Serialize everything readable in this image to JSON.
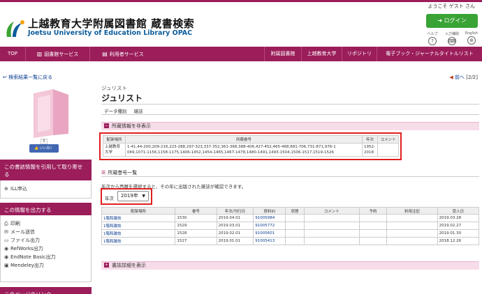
{
  "header": {
    "welcome": "ようこそ ゲスト さん",
    "title": "上越教育大学附属図書館 蔵書検索",
    "subtitle": "Joetsu University of Education Library OPAC",
    "login": "ログイン",
    "tools": [
      {
        "label": "ヘルプ",
        "icon": "?"
      },
      {
        "label": "入力補助",
        "icon": "⌨"
      },
      {
        "label": "English",
        "icon": "⊕"
      }
    ]
  },
  "nav": {
    "items": [
      {
        "label": "TOP",
        "icon": ""
      },
      {
        "label": "図書館サービス",
        "icon": "▥"
      },
      {
        "label": "利用者サービス",
        "icon": "▤"
      },
      {
        "label": "附属図書館",
        "icon": ""
      },
      {
        "label": "上越教育大学",
        "icon": ""
      },
      {
        "label": "リポジトリ",
        "icon": ""
      },
      {
        "label": "電子ブック・ジャーナルタイトルリスト",
        "icon": ""
      }
    ]
  },
  "breadcrumb": {
    "back": "検索結果一覧に戻る",
    "prev": "前へ",
    "page": "[2/2]"
  },
  "record": {
    "kicker": "ジュリスト",
    "title": "ジュリスト",
    "meta_label": "データ種別",
    "meta_value": "雑誌",
    "like_count": "0",
    "like_label": "いいね！"
  },
  "holdings": {
    "toggle_label": "所蔵情報を非表示",
    "headers": [
      "配架場所",
      "所蔵巻号",
      "年次",
      "コメント"
    ],
    "row": {
      "location": "上越教育大学",
      "volumes_1": "1-41,44-200,209-216,223-288,297-323,337-352,361-368,388-406,427-452,465-468,681-706,731-871,976-1",
      "volumes_2": "069,1071-1156,1158-1175,1406-1452,1454-1465,1467-1478,1480-1491,1493-1504,1506-1517,1519-1526",
      "years": "1952-2018",
      "comment": ""
    }
  },
  "volume_list": {
    "title": "所蔵巻号一覧",
    "hint": "年次から西暦を選択すると、その年に出版された雑誌が確認できます。",
    "year_label": "年次",
    "year_value": "2019年",
    "headers": [
      "配架場所",
      "巻号",
      "年次/刊行日",
      "資料ID",
      "状態",
      "コメント",
      "予約",
      "利用注記",
      "受入日"
    ],
    "rows": [
      [
        "1階和雑誌",
        "1530",
        "2019.04.01",
        "91005984",
        "",
        "",
        "",
        "",
        "2019.03.28"
      ],
      [
        "1階和雑誌",
        "1529",
        "2019.03.01",
        "91005772",
        "",
        "",
        "",
        "",
        "2019.02.27"
      ],
      [
        "1階和雑誌",
        "1528",
        "2019.02.01",
        "91005601",
        "",
        "",
        "",
        "",
        "2019.01.30"
      ],
      [
        "1階和雑誌",
        "1527",
        "2019.01.01",
        "91005413",
        "",
        "",
        "",
        "",
        "2018.12.26"
      ]
    ]
  },
  "details_toggle": "書誌詳細を表示",
  "sidebar": {
    "cite_heading": "この書誌情報を引用して取り寄せる",
    "cite_items": [
      {
        "label": "ILL申込",
        "icon": "⊕"
      }
    ],
    "output_heading": "この情報を出力する",
    "output_items": [
      {
        "label": "印刷",
        "icon": "⎙"
      },
      {
        "label": "メール送信",
        "icon": "✉"
      },
      {
        "label": "ファイル出力",
        "icon": "▭"
      },
      {
        "label": "RefWorks出力",
        "icon": "◉"
      },
      {
        "label": "EndNote Basic出力",
        "icon": "◉"
      },
      {
        "label": "Mendeley出力",
        "icon": "▣"
      }
    ],
    "link_heading": "このページのリンク"
  },
  "colors": {
    "brand": "#9b1d5a",
    "login": "#3aa335",
    "highlight": "#e01f1f"
  }
}
